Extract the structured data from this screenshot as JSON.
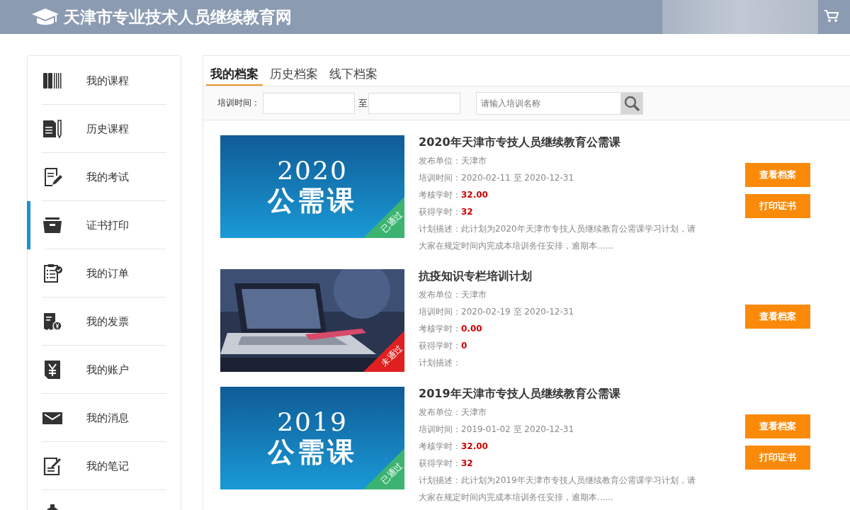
{
  "header": {
    "title": "天津市专业技术人员继续教育网"
  },
  "sidebar": {
    "items": [
      {
        "label": "我的课程",
        "selected": false
      },
      {
        "label": "历史课程",
        "selected": false
      },
      {
        "label": "我的考试",
        "selected": false
      },
      {
        "label": "证书打印",
        "selected": true
      },
      {
        "label": "我的订单",
        "selected": false
      },
      {
        "label": "我的发票",
        "selected": false
      },
      {
        "label": "我的账户",
        "selected": false
      },
      {
        "label": "我的消息",
        "selected": false
      },
      {
        "label": "我的笔记",
        "selected": false
      },
      {
        "selected": false
      }
    ]
  },
  "tabs": [
    {
      "label": "我的档案",
      "selected": true
    },
    {
      "label": "历史档案",
      "selected": false
    },
    {
      "label": "线下档案",
      "selected": false
    }
  ],
  "filter": {
    "label": "培训时间：",
    "separator": "至",
    "search_placeholder": "请输入培训名称"
  },
  "records": [
    {
      "banner": {
        "kind": "banner",
        "year": "2020",
        "text": "公需课"
      },
      "status": "已通过",
      "color": "#3cb371",
      "title": "2020年天津市专技人员继续教育公需课",
      "publisher": "发布单位：天津市",
      "period": "培训时间：2020-02-11 至 2020-12-31",
      "required_label": "考核学时：",
      "required": "32.00",
      "earned_label": "获得学时：",
      "earned": "32",
      "description": "计划描述：此计划为2020年天津市专技人员继续教育公需课学习计划，请大家在规定时间内完成本培训务任安排，逾期本......",
      "buttons": [
        "查看档案",
        "打印证书"
      ]
    },
    {
      "banner": {
        "kind": "picture"
      },
      "status": "未通过",
      "color": "#e02020",
      "title": "抗疫知识专栏培训计划",
      "publisher": "发布单位：天津市",
      "period": "培训时间：2020-02-19 至 2020-12-31",
      "required_label": "考核学时：",
      "required": "0.00",
      "earned_label": "获得学时：",
      "earned": "0",
      "description": "计划描述：",
      "buttons": [
        "查看档案"
      ]
    },
    {
      "banner": {
        "kind": "banner",
        "year": "2019",
        "text": "公需课"
      },
      "status": "已通过",
      "color": "#3cb371",
      "title": "2019年天津市专技人员继续教育公需课",
      "publisher": "发布单位：天津市",
      "period": "培训时间：2019-01-02 至 2020-12-31",
      "required_label": "考核学时：",
      "required": "32.00",
      "earned_label": "获得学时：",
      "earned": "32",
      "description": "计划描述：此计划为2019年天津市专技人员继续教育公需课学习计划，请大家在规定时间内完成本培训务任安排，逾期本......",
      "buttons": [
        "查看档案",
        "打印证书"
      ]
    }
  ]
}
